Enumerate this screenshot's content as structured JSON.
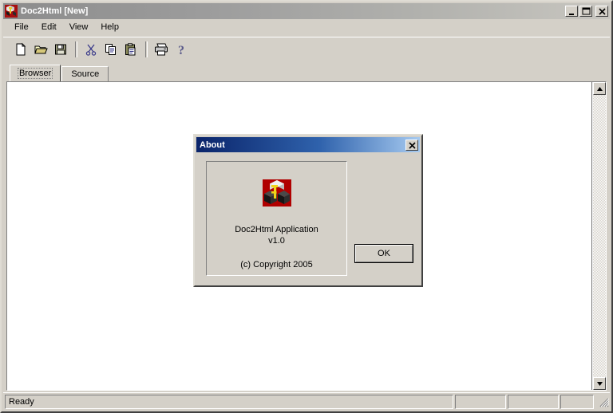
{
  "window": {
    "title": "Doc2Html [New]",
    "icon": "app-icon",
    "controls": {
      "minimize": "minimize-button",
      "maximize": "maximize-button",
      "close": "close-button"
    }
  },
  "menubar": {
    "items": [
      {
        "label": "File"
      },
      {
        "label": "Edit"
      },
      {
        "label": "View"
      },
      {
        "label": "Help"
      }
    ]
  },
  "toolbar": {
    "buttons": [
      {
        "name": "new-document-icon",
        "tooltip": "New"
      },
      {
        "name": "open-folder-icon",
        "tooltip": "Open"
      },
      {
        "name": "save-floppy-icon",
        "tooltip": "Save"
      },
      {
        "name": "separator-1",
        "tooltip": ""
      },
      {
        "name": "cut-scissors-icon",
        "tooltip": "Cut"
      },
      {
        "name": "copy-icon",
        "tooltip": "Copy"
      },
      {
        "name": "paste-clipboard-icon",
        "tooltip": "Paste"
      },
      {
        "name": "separator-2",
        "tooltip": ""
      },
      {
        "name": "print-icon",
        "tooltip": "Print"
      },
      {
        "name": "help-question-icon",
        "tooltip": "About"
      }
    ]
  },
  "tabs": {
    "items": [
      {
        "label": "Browser",
        "active": true
      },
      {
        "label": "Source",
        "active": false
      }
    ]
  },
  "document": {
    "content": ""
  },
  "scrollbar": {
    "up_arrow": "scroll-up-arrow",
    "down_arrow": "scroll-down-arrow"
  },
  "statusbar": {
    "message": "Ready",
    "panes": [
      "",
      "",
      ""
    ]
  },
  "dialog": {
    "title": "About",
    "close_label": "close-icon",
    "logo": "doc2html-logo",
    "app_name": "Doc2Html Application",
    "version": "v1.0",
    "copyright": "(c) Copyright 2005",
    "ok_label": "OK"
  },
  "colors": {
    "face": "#d4d0c8",
    "dialog_title_start": "#0a246a",
    "dialog_title_end": "#a6caf0",
    "window_title_start": "#8c8c8c",
    "window_title_end": "#c8c6c0",
    "client_bg": "#ffffff",
    "logo_red": "#b00000"
  }
}
